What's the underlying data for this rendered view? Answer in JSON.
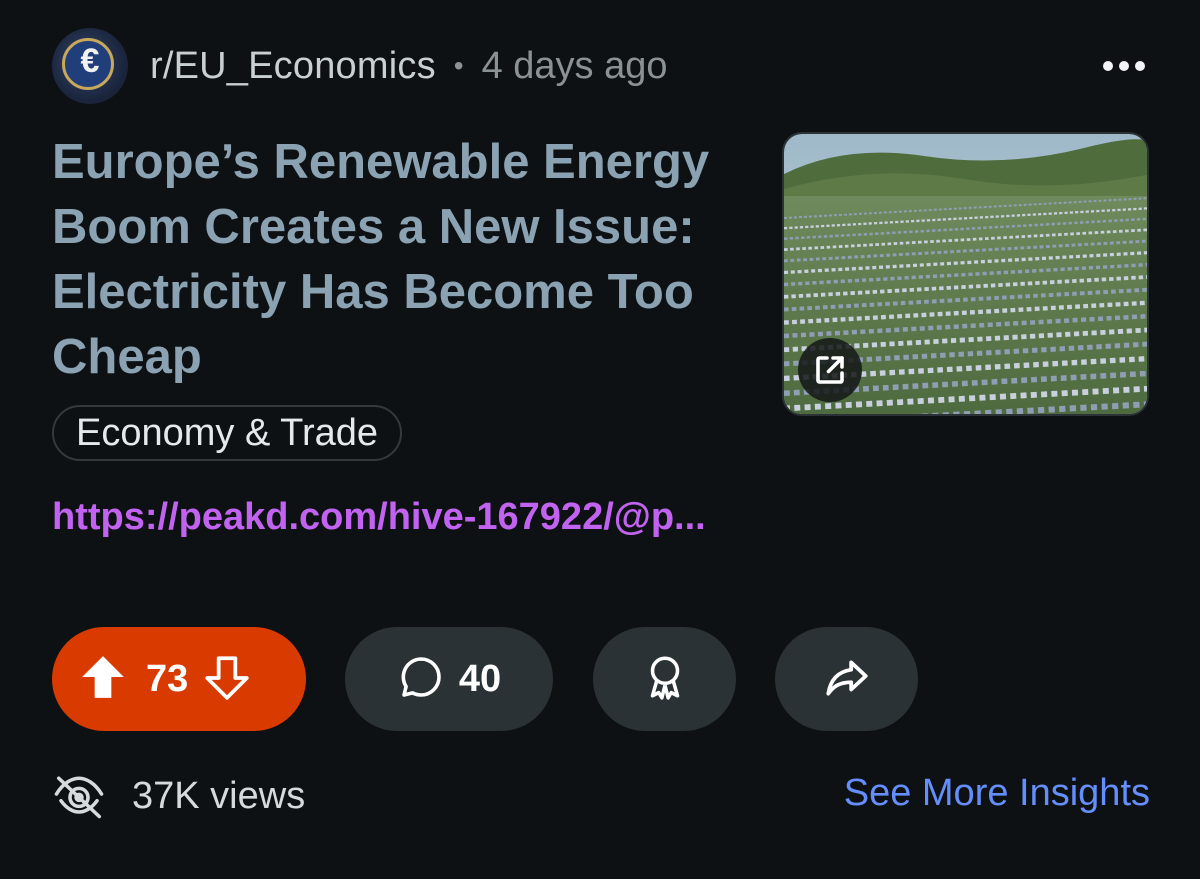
{
  "header": {
    "subreddit": "r/EU_Economics",
    "separator": "•",
    "time_ago": "4 days ago",
    "avatar_icon": "euro-coin-icon",
    "more_icon": "more-options-icon"
  },
  "post": {
    "title": "Europe’s Renewable Energy Boom Creates a New Issue: Electricity Has Become Too Cheap",
    "flair": "Economy & Trade",
    "link": "https://peakd.com/hive-167922/@p..."
  },
  "thumbnail": {
    "icon": "external-link-icon"
  },
  "actions": {
    "score": "73",
    "comments": "40",
    "accent": "#d93a00",
    "upvote_icon": "upvote-icon",
    "downvote_icon": "downvote-icon",
    "comment_icon": "comment-icon",
    "award_icon": "award-icon",
    "share_icon": "share-icon"
  },
  "footer": {
    "views": "37K views",
    "insights": "See More Insights",
    "views_icon": "eye-icon"
  }
}
